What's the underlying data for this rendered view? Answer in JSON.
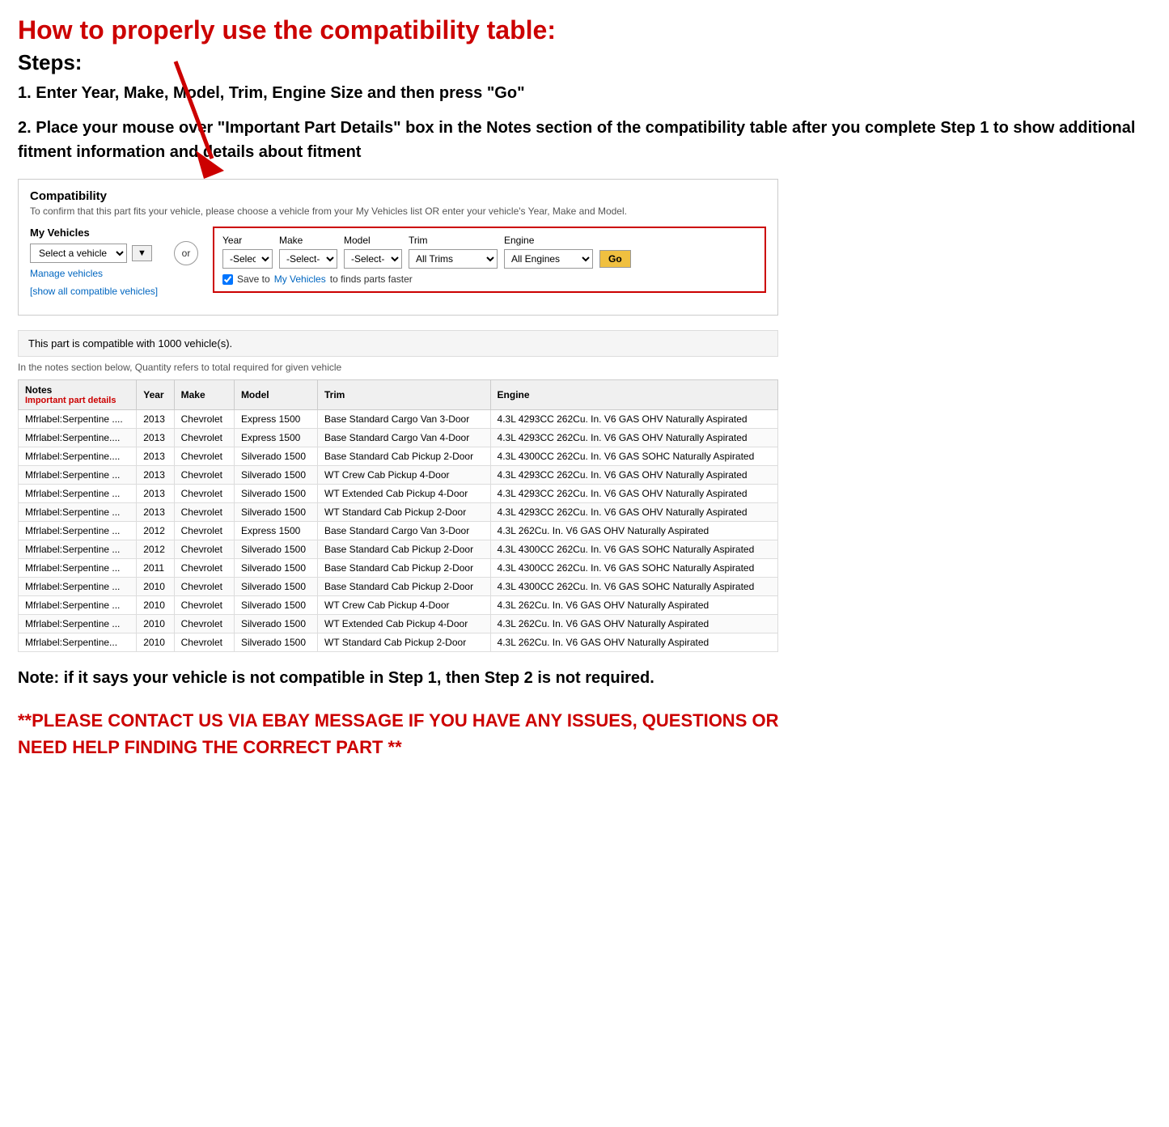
{
  "page": {
    "main_title": "How to properly use the compatibility table:",
    "steps_heading": "Steps:",
    "step1": "1. Enter Year, Make, Model, Trim, Engine Size and then press \"Go\"",
    "step2": "2. Place your mouse over \"Important Part Details\" box in the Notes section of the compatibility table after you complete Step 1 to show additional fitment information and details about fitment",
    "note_text": "Note: if it says your vehicle is not compatible in Step 1, then Step 2 is not required.",
    "contact_text": "**PLEASE CONTACT US VIA EBAY MESSAGE IF YOU HAVE ANY ISSUES, QUESTIONS OR NEED HELP FINDING THE CORRECT PART **"
  },
  "compatibility_section": {
    "title": "Compatibility",
    "subtitle": "To confirm that this part fits your vehicle, please choose a vehicle from your My Vehicles list OR enter your vehicle's Year, Make and Model.",
    "my_vehicles_label": "My Vehicles",
    "select_vehicle_placeholder": "Select a vehicle",
    "manage_vehicles": "Manage vehicles",
    "show_all": "[show all compatible vehicles]",
    "or_label": "or",
    "year_label": "Year",
    "make_label": "Make",
    "model_label": "Model",
    "trim_label": "Trim",
    "engine_label": "Engine",
    "year_value": "-Select-",
    "make_value": "-Select-",
    "model_value": "-Select-",
    "trim_value": "All Trims",
    "engine_value": "All Engines",
    "go_label": "Go",
    "save_label": "Save to",
    "my_vehicles_link": "My Vehicles",
    "save_suffix": "to finds parts faster",
    "compat_notice": "This part is compatible with 1000 vehicle(s).",
    "quantity_note": "In the notes section below, Quantity refers to total required for given vehicle"
  },
  "table": {
    "columns": [
      "Notes",
      "Year",
      "Make",
      "Model",
      "Trim",
      "Engine"
    ],
    "notes_sub": "Important part details",
    "rows": [
      {
        "notes": "Mfrlabel:Serpentine ....",
        "year": "2013",
        "make": "Chevrolet",
        "model": "Express 1500",
        "trim": "Base Standard Cargo Van 3-Door",
        "engine": "4.3L 4293CC 262Cu. In. V6 GAS OHV Naturally Aspirated"
      },
      {
        "notes": "Mfrlabel:Serpentine....",
        "year": "2013",
        "make": "Chevrolet",
        "model": "Express 1500",
        "trim": "Base Standard Cargo Van 4-Door",
        "engine": "4.3L 4293CC 262Cu. In. V6 GAS OHV Naturally Aspirated"
      },
      {
        "notes": "Mfrlabel:Serpentine....",
        "year": "2013",
        "make": "Chevrolet",
        "model": "Silverado 1500",
        "trim": "Base Standard Cab Pickup 2-Door",
        "engine": "4.3L 4300CC 262Cu. In. V6 GAS SOHC Naturally Aspirated"
      },
      {
        "notes": "Mfrlabel:Serpentine ...",
        "year": "2013",
        "make": "Chevrolet",
        "model": "Silverado 1500",
        "trim": "WT Crew Cab Pickup 4-Door",
        "engine": "4.3L 4293CC 262Cu. In. V6 GAS OHV Naturally Aspirated"
      },
      {
        "notes": "Mfrlabel:Serpentine ...",
        "year": "2013",
        "make": "Chevrolet",
        "model": "Silverado 1500",
        "trim": "WT Extended Cab Pickup 4-Door",
        "engine": "4.3L 4293CC 262Cu. In. V6 GAS OHV Naturally Aspirated"
      },
      {
        "notes": "Mfrlabel:Serpentine ...",
        "year": "2013",
        "make": "Chevrolet",
        "model": "Silverado 1500",
        "trim": "WT Standard Cab Pickup 2-Door",
        "engine": "4.3L 4293CC 262Cu. In. V6 GAS OHV Naturally Aspirated"
      },
      {
        "notes": "Mfrlabel:Serpentine ...",
        "year": "2012",
        "make": "Chevrolet",
        "model": "Express 1500",
        "trim": "Base Standard Cargo Van 3-Door",
        "engine": "4.3L 262Cu. In. V6 GAS OHV Naturally Aspirated"
      },
      {
        "notes": "Mfrlabel:Serpentine ...",
        "year": "2012",
        "make": "Chevrolet",
        "model": "Silverado 1500",
        "trim": "Base Standard Cab Pickup 2-Door",
        "engine": "4.3L 4300CC 262Cu. In. V6 GAS SOHC Naturally Aspirated"
      },
      {
        "notes": "Mfrlabel:Serpentine ...",
        "year": "2011",
        "make": "Chevrolet",
        "model": "Silverado 1500",
        "trim": "Base Standard Cab Pickup 2-Door",
        "engine": "4.3L 4300CC 262Cu. In. V6 GAS SOHC Naturally Aspirated"
      },
      {
        "notes": "Mfrlabel:Serpentine ...",
        "year": "2010",
        "make": "Chevrolet",
        "model": "Silverado 1500",
        "trim": "Base Standard Cab Pickup 2-Door",
        "engine": "4.3L 4300CC 262Cu. In. V6 GAS SOHC Naturally Aspirated"
      },
      {
        "notes": "Mfrlabel:Serpentine ...",
        "year": "2010",
        "make": "Chevrolet",
        "model": "Silverado 1500",
        "trim": "WT Crew Cab Pickup 4-Door",
        "engine": "4.3L 262Cu. In. V6 GAS OHV Naturally Aspirated"
      },
      {
        "notes": "Mfrlabel:Serpentine ...",
        "year": "2010",
        "make": "Chevrolet",
        "model": "Silverado 1500",
        "trim": "WT Extended Cab Pickup 4-Door",
        "engine": "4.3L 262Cu. In. V6 GAS OHV Naturally Aspirated"
      },
      {
        "notes": "Mfrlabel:Serpentine...",
        "year": "2010",
        "make": "Chevrolet",
        "model": "Silverado 1500",
        "trim": "WT Standard Cab Pickup 2-Door",
        "engine": "4.3L 262Cu. In. V6 GAS OHV Naturally Aspirated"
      }
    ]
  }
}
